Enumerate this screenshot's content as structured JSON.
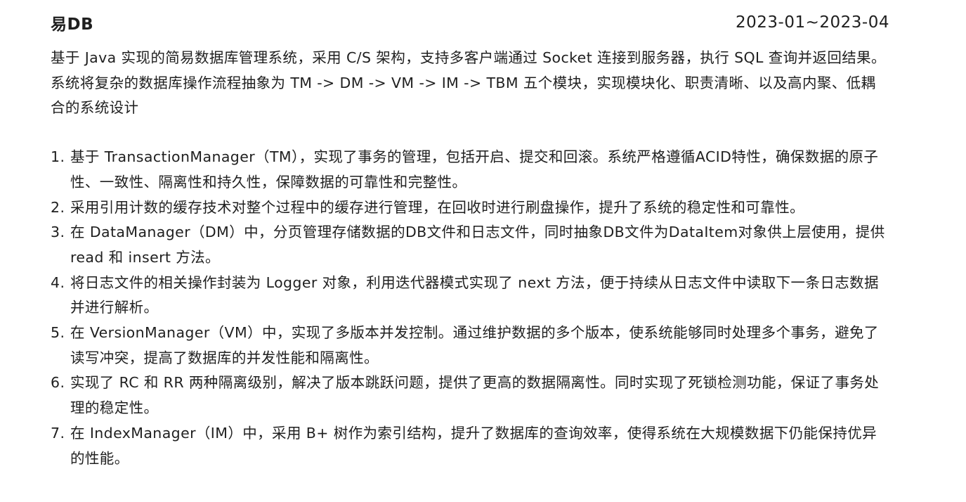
{
  "project": {
    "title": "易DB",
    "period": "2023-01~2023-04",
    "summary": "基于 Java 实现的简易数据库管理系统，采用 C/S 架构，支持多客户端通过 Socket 连接到服务器，执行 SQL 查询并返回结果。系统将复杂的数据库操作流程抽象为 TM -> DM -> VM -> IM -> TBM 五个模块，实现模块化、职责清晰、以及高内聚、低耦合的系统设计"
  },
  "points": [
    {
      "num": "1.",
      "text": "基于 TransactionManager（TM），实现了事务的管理，包括开启、提交和回滚。系统严格遵循ACID特性，确保数据的原子性、一致性、隔离性和持久性，保障数据的可靠性和完整性。"
    },
    {
      "num": "2.",
      "text": "采用引用计数的缓存技术对整个过程中的缓存进行管理，在回收时进行刷盘操作，提升了系统的稳定性和可靠性。"
    },
    {
      "num": "3.",
      "text": "在 DataManager（DM）中，分页管理存储数据的DB文件和日志文件，同时抽象DB文件为DataItem对象供上层使用，提供 read 和 insert 方法。"
    },
    {
      "num": "4.",
      "text": "将日志文件的相关操作封装为 Logger 对象，利用迭代器模式实现了 next 方法，便于持续从日志文件中读取下一条日志数据并进行解析。"
    },
    {
      "num": "5.",
      "text": "在 VersionManager（VM）中，实现了多版本并发控制。通过维护数据的多个版本，使系统能够同时处理多个事务，避免了读写冲突，提高了数据库的并发性能和隔离性。"
    },
    {
      "num": "6.",
      "text": "实现了 RC 和 RR 两种隔离级别，解决了版本跳跃问题，提供了更高的数据隔离性。同时实现了死锁检测功能，保证了事务处理的稳定性。"
    },
    {
      "num": "7.",
      "text": "在 IndexManager（IM）中，采用 B+ 树作为索引结构，提升了数据库的查询效率，使得系统在大规模数据下仍能保持优异的性能。"
    }
  ]
}
